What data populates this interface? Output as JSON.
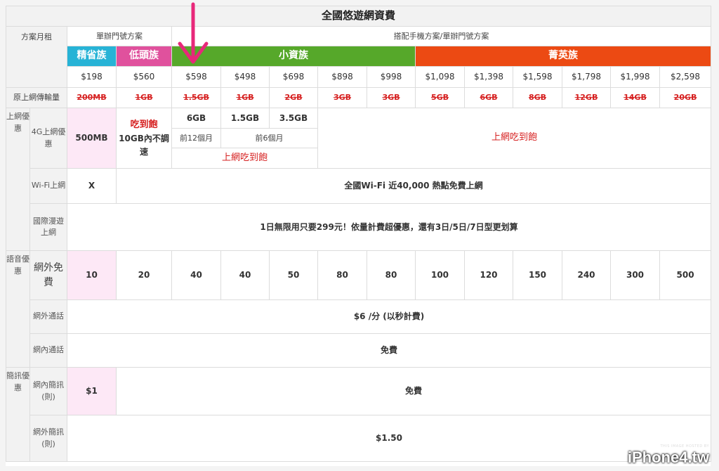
{
  "title": "全國悠遊網資費",
  "header": {
    "plan_col": "方案月租",
    "sub1": "單辦門號方案",
    "sub2": "搭配手機方案/單辦門號方案"
  },
  "groups": {
    "g1": "精省族",
    "g2": "低頭族",
    "g3": "小資族",
    "g4": "菁英族"
  },
  "prices": [
    "$198",
    "$560",
    "$598",
    "$498",
    "$698",
    "$898",
    "$998",
    "$1,098",
    "$1,398",
    "$1,598",
    "$1,798",
    "$1,998",
    "$2,598"
  ],
  "orig": {
    "label": "原上網傳輸量",
    "values": [
      "200MB",
      "1GB",
      "1.5GB",
      "1GB",
      "2GB",
      "3GB",
      "3GB",
      "5GB",
      "6GB",
      "8GB",
      "12GB",
      "14GB",
      "20GB"
    ]
  },
  "data_section": {
    "cat": "上網優惠",
    "g4_label": "4G上網優惠",
    "v1": "500MB",
    "v2_red": "吃到飽",
    "v2_black": "10GB內不調速",
    "a": "6GB",
    "b": "1.5GB",
    "c": "3.5GB",
    "first12": "前12個月",
    "first6": "前6個月",
    "unlimited_small": "上網吃到飽",
    "unlimited_big": "上網吃到飽",
    "wifi_label": "Wi-Fi上網",
    "wifi_x": "X",
    "wifi_text": "全國Wi-Fi 近40,000 熱點免費上網",
    "roam_label": "國際漫遊上網",
    "roam_text": "1日無限用只要299元！依量計費超優惠，還有3日/5日/7日型更划算"
  },
  "voice": {
    "cat": "語音優惠",
    "label": "網外免費",
    "values": [
      "10",
      "20",
      "40",
      "40",
      "50",
      "80",
      "80",
      "100",
      "120",
      "150",
      "240",
      "300",
      "500"
    ],
    "out_label": "網外通話",
    "out_text": "$6 /分 (以秒計費)",
    "in_label": "網內通話",
    "in_text": "免費"
  },
  "sms": {
    "cat": "簡訊優惠",
    "in_label": "網內簡訊(則)",
    "in_v1": "$1",
    "in_text": "免費",
    "out_label": "網外簡訊(則)",
    "out_text": "$1.50"
  },
  "watermark": {
    "small": "THIS IMAGE HOSTED BY",
    "logo": "iPhone4.tw"
  },
  "colors": {
    "cyan": "#27b3d6",
    "pink": "#e0519d",
    "green": "#56a82a",
    "orange": "#ec4a13",
    "arrow": "#e8287a",
    "red_text": "#d62020"
  }
}
